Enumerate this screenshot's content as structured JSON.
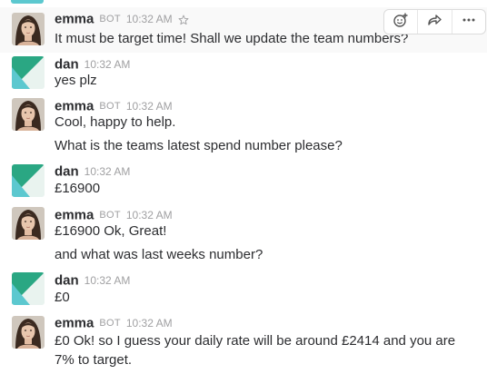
{
  "messages": [
    {
      "sender": "emma",
      "bot_tag": "BOT",
      "time": "10:32 AM",
      "avatar": "emma-photo-avatar",
      "lines": [
        "It must be target time! Shall we update the team numbers?"
      ]
    },
    {
      "sender": "dan",
      "time": "10:32 AM",
      "avatar": "dan-geometric-avatar",
      "lines": [
        "yes plz"
      ]
    },
    {
      "sender": "emma",
      "bot_tag": "BOT",
      "time": "10:32 AM",
      "avatar": "emma-photo-avatar",
      "lines": [
        "Cool, happy to help.",
        "What is the teams latest spend number please?"
      ]
    },
    {
      "sender": "dan",
      "time": "10:32 AM",
      "avatar": "dan-geometric-avatar",
      "lines": [
        "£16900"
      ]
    },
    {
      "sender": "emma",
      "bot_tag": "BOT",
      "time": "10:32 AM",
      "avatar": "emma-photo-avatar",
      "lines": [
        "£16900 Ok, Great!",
        "and what was last weeks number?"
      ]
    },
    {
      "sender": "dan",
      "time": "10:32 AM",
      "avatar": "dan-geometric-avatar",
      "lines": [
        "£0"
      ]
    },
    {
      "sender": "emma",
      "bot_tag": "BOT",
      "time": "10:32 AM",
      "avatar": "emma-photo-avatar",
      "lines": [
        "£0 Ok! so I guess your daily rate will be around £2414 and you are",
        "7% to target."
      ]
    }
  ],
  "hover_actions": {
    "icons": [
      "add-reaction-icon",
      "share-icon",
      "more-actions-icon"
    ]
  },
  "icons": {
    "star": "star-icon"
  },
  "colors": {
    "text": "#2c2d30",
    "muted": "#a0a0a2",
    "hover_bg": "#f9f9f9",
    "dan_green": "#2aa783",
    "dan_teal": "#5cc8cf",
    "dan_light": "#e9f3ef"
  }
}
